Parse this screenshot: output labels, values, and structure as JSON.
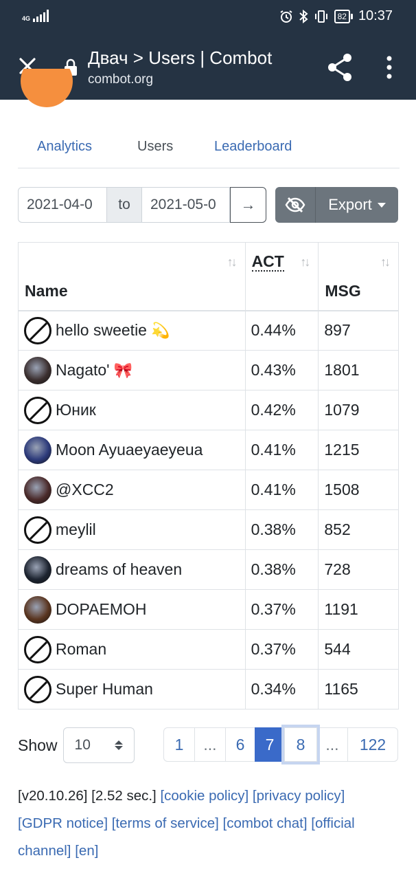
{
  "status_bar": {
    "network": "4G",
    "battery": "82",
    "time": "10:37",
    "icons": [
      "signal-icon",
      "alarm-icon",
      "bluetooth-icon",
      "vibrate-icon",
      "battery-icon"
    ]
  },
  "browser": {
    "title": "Двач > Users | Combot",
    "url": "combot.org",
    "icons": [
      "close-icon",
      "lock-icon",
      "share-icon",
      "more-vert-icon"
    ]
  },
  "tabs": [
    {
      "label": "Analytics",
      "active": false
    },
    {
      "label": "Users",
      "active": true
    },
    {
      "label": "Leaderboard",
      "active": false
    }
  ],
  "filter": {
    "date_from": "2021-04-0",
    "to_label": "to",
    "date_to": "2021-05-0",
    "go_label": "→",
    "export_label": "Export"
  },
  "table": {
    "headers": {
      "name": "Name",
      "act": "ACT",
      "msg": "MSG",
      "sort_icon": "↑↓"
    },
    "rows": [
      {
        "name": "hello sweetie",
        "emoji": "💫",
        "act": "0.44%",
        "msg": "897",
        "avatar": "none"
      },
      {
        "name": "Nagato'",
        "emoji": "🎀",
        "act": "0.43%",
        "msg": "1801",
        "avatar": "photo",
        "color": "#3b2f2f"
      },
      {
        "name": "Юник",
        "emoji": "",
        "act": "0.42%",
        "msg": "1079",
        "avatar": "none"
      },
      {
        "name": "Moon Ayuaeyaeyeua",
        "emoji": "",
        "act": "0.41%",
        "msg": "1215",
        "avatar": "photo",
        "color": "#2c3a7a"
      },
      {
        "name": "@XCC2",
        "emoji": "",
        "act": "0.41%",
        "msg": "1508",
        "avatar": "photo",
        "color": "#4a2a2a"
      },
      {
        "name": "meylil",
        "emoji": "",
        "act": "0.38%",
        "msg": "852",
        "avatar": "none"
      },
      {
        "name": "dreams of heaven",
        "emoji": "",
        "act": "0.38%",
        "msg": "728",
        "avatar": "photo",
        "color": "#1d2430"
      },
      {
        "name": "DOPAEMOH",
        "emoji": "",
        "act": "0.37%",
        "msg": "1191",
        "avatar": "photo",
        "color": "#5a3520"
      },
      {
        "name": "Roman",
        "emoji": "",
        "act": "0.37%",
        "msg": "544",
        "avatar": "none"
      },
      {
        "name": "Super Human",
        "emoji": "",
        "act": "0.34%",
        "msg": "1165",
        "avatar": "none"
      }
    ]
  },
  "pagination": {
    "show_label": "Show",
    "page_size": "10",
    "pages": [
      {
        "label": "1",
        "type": "page"
      },
      {
        "label": "...",
        "type": "dots"
      },
      {
        "label": "6",
        "type": "page"
      },
      {
        "label": "7",
        "type": "active"
      },
      {
        "label": "8",
        "type": "focus"
      },
      {
        "label": "...",
        "type": "dots"
      },
      {
        "label": "122",
        "type": "page"
      }
    ]
  },
  "footer": {
    "version": "[v20.10.26]",
    "time": "[2.52 sec.]",
    "links": [
      "[cookie policy]",
      "[privacy policy]",
      "[GDPR notice]",
      "[terms of service]",
      "[combot chat]",
      "[official channel]",
      "[en]"
    ]
  }
}
